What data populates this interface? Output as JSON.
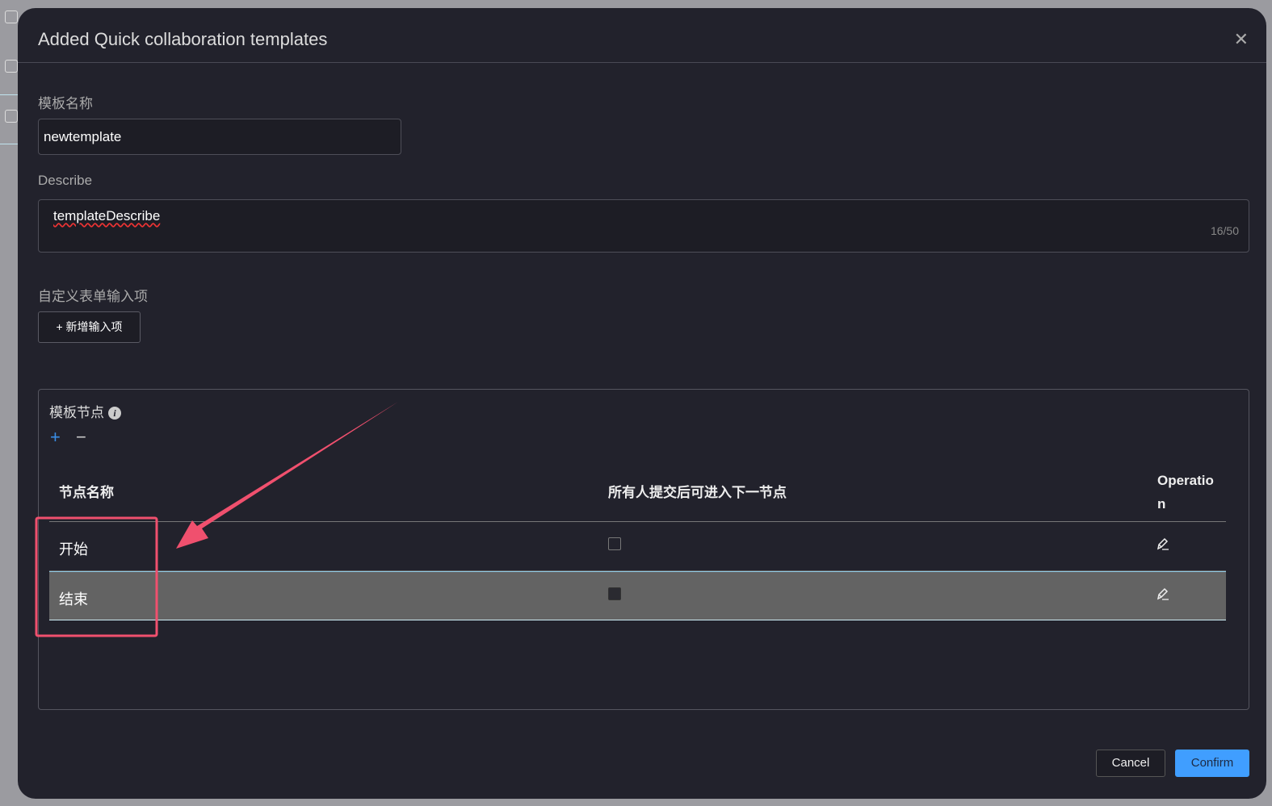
{
  "dialog": {
    "title": "Added Quick collaboration templates",
    "close_icon": "close-icon"
  },
  "form": {
    "name_label": "模板名称",
    "name_value": "newtemplate",
    "describe_label": "Describe",
    "describe_value": "templateDescribe",
    "describe_count": "16/50",
    "custom_label": "自定义表单输入项",
    "add_input_button": "+ 新增输入项"
  },
  "nodes": {
    "title": "模板节点",
    "add_icon": "plus-icon",
    "remove_icon": "minus-icon",
    "columns": [
      "节点名称",
      "所有人提交后可进入下一节点",
      "Operatio\nn"
    ],
    "rows": [
      {
        "name": "开始",
        "checked": false,
        "selected": false
      },
      {
        "name": "结束",
        "checked": false,
        "selected": true
      }
    ]
  },
  "footer": {
    "cancel": "Cancel",
    "confirm": "Confirm"
  },
  "colors": {
    "primary": "#409eff",
    "annotation": "#f0506e",
    "modal_bg": "#22222c"
  }
}
